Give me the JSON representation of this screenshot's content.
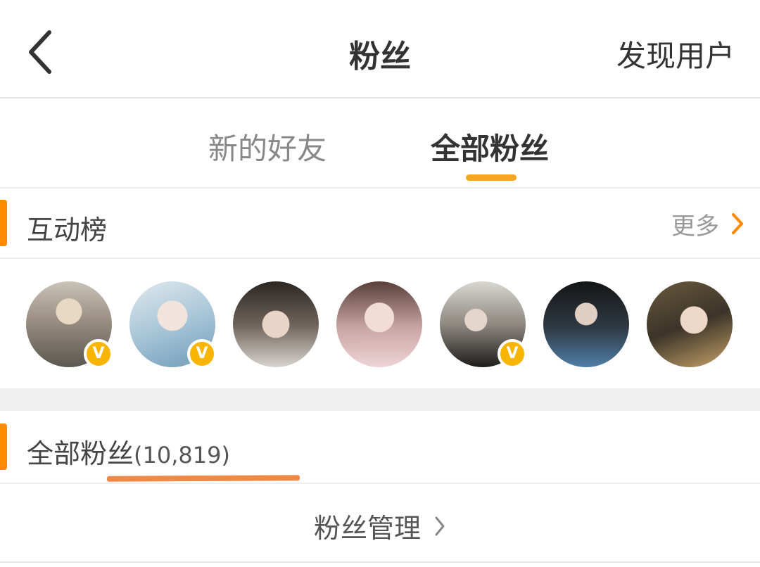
{
  "header": {
    "title": "粉丝",
    "discover_label": "发现用户",
    "back_icon": "chevron-left-icon"
  },
  "tabs": [
    {
      "label": "新的好友",
      "active": false
    },
    {
      "label": "全部粉丝",
      "active": true
    }
  ],
  "interaction_rank": {
    "title": "互动榜",
    "more_label": "更多",
    "avatars": [
      {
        "verified": true,
        "badge": "V"
      },
      {
        "verified": true,
        "badge": "V"
      },
      {
        "verified": false,
        "badge": ""
      },
      {
        "verified": false,
        "badge": ""
      },
      {
        "verified": true,
        "badge": "V"
      },
      {
        "verified": false,
        "badge": ""
      },
      {
        "verified": false,
        "badge": ""
      }
    ]
  },
  "all_fans": {
    "title": "全部粉丝",
    "count": "(10,819)"
  },
  "fan_management": {
    "label": "粉丝管理"
  },
  "colors": {
    "accent_orange": "#ff8a00",
    "tab_indicator": "#f5a623",
    "verified_badge": "#f7b500",
    "underline_mark": "#ee8a45"
  }
}
